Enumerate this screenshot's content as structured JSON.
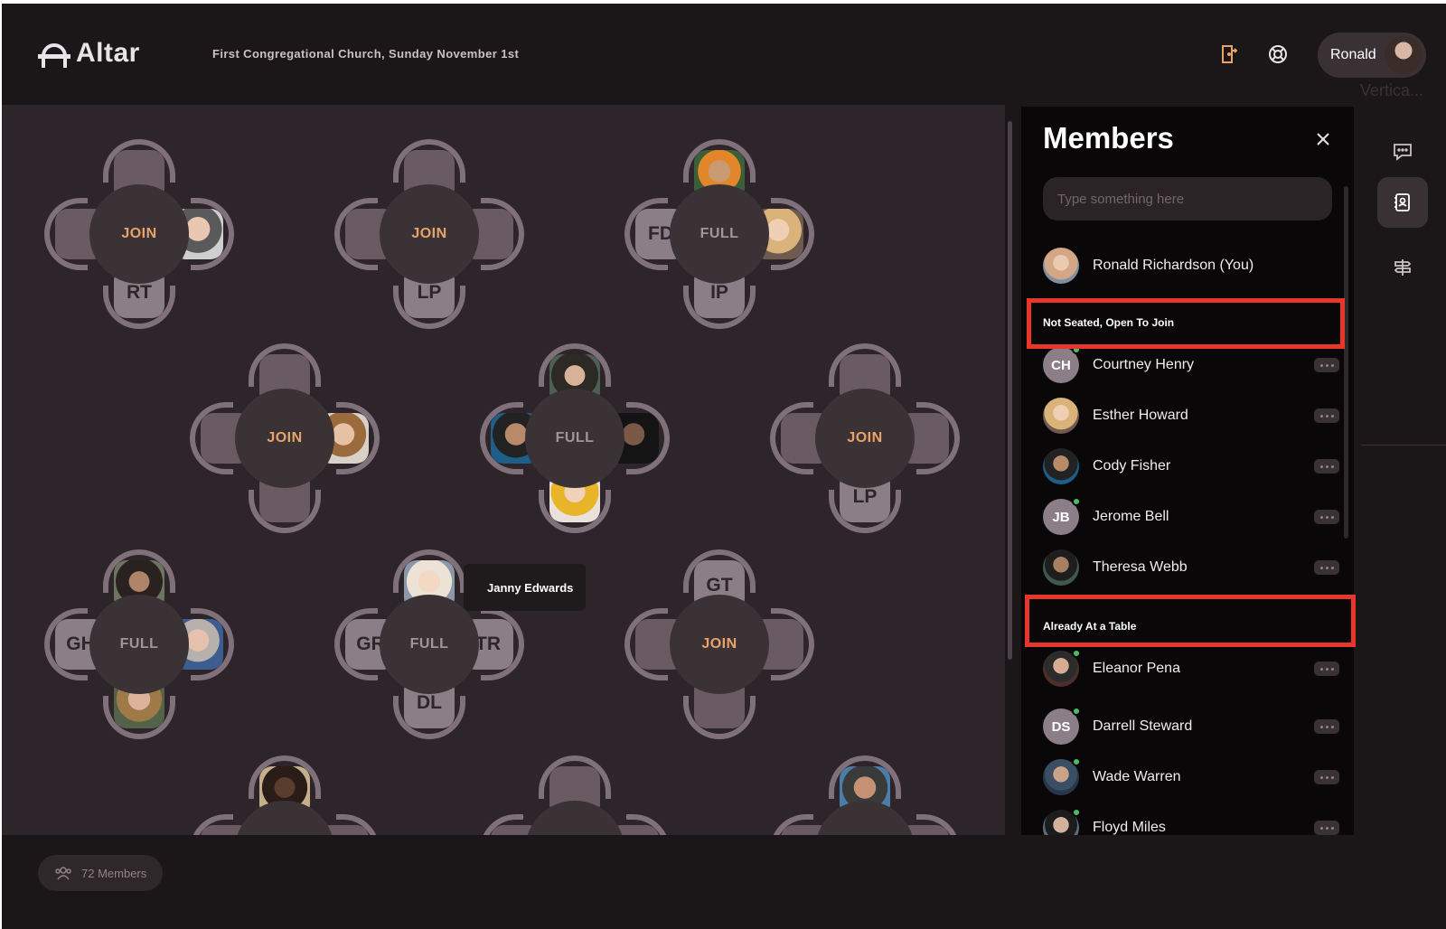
{
  "app": {
    "name": "Altar",
    "event_title": "First Congregational Church, Sunday November 1st",
    "user_name": "Ronald",
    "ghost_label": "Vertica..."
  },
  "icons": {
    "logo": "altar-logo-icon",
    "leave": "door-exit-icon",
    "help": "lifebuoy-icon",
    "chat": "chat-icon",
    "contacts": "contacts-icon",
    "signpost": "signpost-icon",
    "close": "close-icon",
    "members": "people-icon"
  },
  "colors": {
    "accent_join": "#e8a36a",
    "online": "#4ebc65",
    "highlight": "#e8372a"
  },
  "tables": {
    "t1": {
      "hub": "JOIN",
      "right": "",
      "bottom": "RT"
    },
    "t2": {
      "hub": "JOIN",
      "bottom": "LP"
    },
    "t3": {
      "hub": "FULL",
      "left": "FD",
      "bottom": "IP"
    },
    "t4": {
      "hub": "JOIN"
    },
    "t5": {
      "hub": "FULL"
    },
    "t6": {
      "hub": "JOIN",
      "bottom": "LP"
    },
    "t7": {
      "hub": "FULL",
      "left": "GH"
    },
    "t8": {
      "hub": "FULL",
      "left": "GR",
      "right": "TR",
      "bottom": "DL"
    },
    "t9": {
      "hub": "JOIN",
      "top": "GT"
    }
  },
  "tooltip": "Janny Edwards",
  "footer": {
    "members_count": "72 Members"
  },
  "panel": {
    "title": "Members",
    "search_placeholder": "Type something here",
    "you": {
      "name": "Ronald Richardson (You)"
    },
    "sections": [
      {
        "title": "Not Seated, Open To Join",
        "members": [
          {
            "name": "Courtney Henry",
            "initials": "CH",
            "online": true
          },
          {
            "name": "Esther Howard",
            "initials": "",
            "online": false
          },
          {
            "name": "Cody Fisher",
            "initials": "",
            "online": false
          },
          {
            "name": "Jerome Bell",
            "initials": "JB",
            "online": true
          },
          {
            "name": "Theresa Webb",
            "initials": "",
            "online": false
          }
        ]
      },
      {
        "title": "Already At a Table",
        "members": [
          {
            "name": "Eleanor Pena",
            "initials": "",
            "online": true
          },
          {
            "name": "Darrell Steward",
            "initials": "DS",
            "online": true
          },
          {
            "name": "Wade Warren",
            "initials": "",
            "online": true
          },
          {
            "name": "Floyd Miles",
            "initials": "",
            "online": true
          }
        ]
      }
    ]
  }
}
